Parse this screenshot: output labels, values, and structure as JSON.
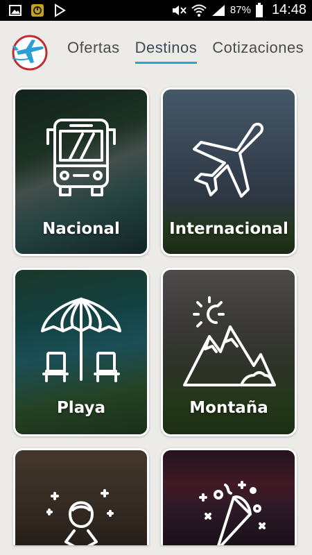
{
  "status_bar": {
    "icons_left": [
      "image-icon",
      "power-app-icon",
      "play-store-icon"
    ],
    "icons_right": [
      "mute-icon",
      "wifi-icon",
      "signal-icon",
      "battery-icon"
    ],
    "battery": "87%",
    "time": "14:48"
  },
  "app": {
    "logo": "airplane-logo",
    "tabs": [
      {
        "label": "Ofertas",
        "active": false
      },
      {
        "label": "Destinos",
        "active": true
      },
      {
        "label": "Cotizaciones",
        "active": false
      }
    ],
    "accent_color": "#29a1d8"
  },
  "cards": [
    {
      "label": "Nacional",
      "icon": "bus-icon"
    },
    {
      "label": "Internacional",
      "icon": "airplane-icon"
    },
    {
      "label": "Playa",
      "icon": "beach-umbrella-icon"
    },
    {
      "label": "Montaña",
      "icon": "mountain-icon"
    },
    {
      "label": "",
      "icon": "yoga-icon"
    },
    {
      "label": "",
      "icon": "party-popper-icon"
    }
  ]
}
